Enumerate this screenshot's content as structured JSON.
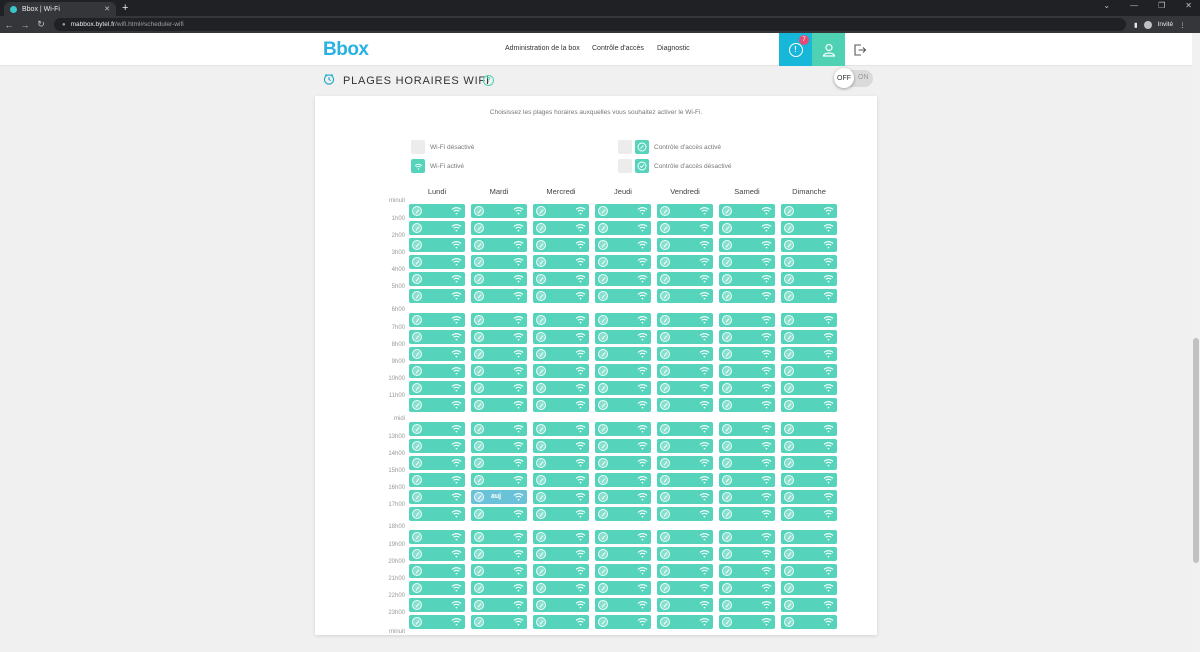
{
  "browser": {
    "tab_title": "Bbox | Wi-Fi",
    "tab_close": "✕",
    "new_tab": "+",
    "window_controls": [
      "⌄",
      "—",
      "❐",
      "✕"
    ],
    "nav_back": "←",
    "nav_forward": "→",
    "nav_reload": "↻",
    "url_host": "mabbox.bytel.fr",
    "url_path": "/wifi.html#scheduler-wifi",
    "profile_label": "Invité"
  },
  "header": {
    "logo": "Bbox",
    "nav": [
      "Administration de la box",
      "Contrôle d'accès",
      "Diagnostic"
    ],
    "notif_symbol": "!",
    "notif_count": "7"
  },
  "section": {
    "title": "PLAGES HORAIRES WIFI",
    "help": "?",
    "toggle_off": "OFF",
    "toggle_on": "ON"
  },
  "card": {
    "intro": "Choisissez les plages horaires auxquelles vous souhaitez activer le Wi-Fi.",
    "legend": {
      "wifi_off": "Wi-Fi désactivé",
      "wifi_on": "Wi-Fi activé",
      "access_on": "Contrôle d'accès activé",
      "access_off": "Contrôle d'accès désactivé"
    }
  },
  "schedule": {
    "days": [
      "Lundi",
      "Mardi",
      "Mercredi",
      "Jeudi",
      "Vendredi",
      "Samedi",
      "Dimanche"
    ],
    "hours": [
      "minuit",
      "1h00",
      "2h00",
      "3h00",
      "4h00",
      "5h00",
      "6h00",
      "7h00",
      "8h00",
      "9h00",
      "10h00",
      "11h00",
      "midi",
      "13h00",
      "14h00",
      "15h00",
      "16h00",
      "17h00",
      "18h00",
      "19h00",
      "20h00",
      "21h00",
      "22h00",
      "23h00",
      "minuit"
    ],
    "today_label": "auj",
    "today_day_index": 1,
    "today_slot_index": 16,
    "all_slots_wifi_on": true,
    "colors": {
      "wifi_on": "#56d4bb",
      "today": "#6ac2d8",
      "wifi_off": "#ececec",
      "accent": "#16b7d9"
    }
  }
}
